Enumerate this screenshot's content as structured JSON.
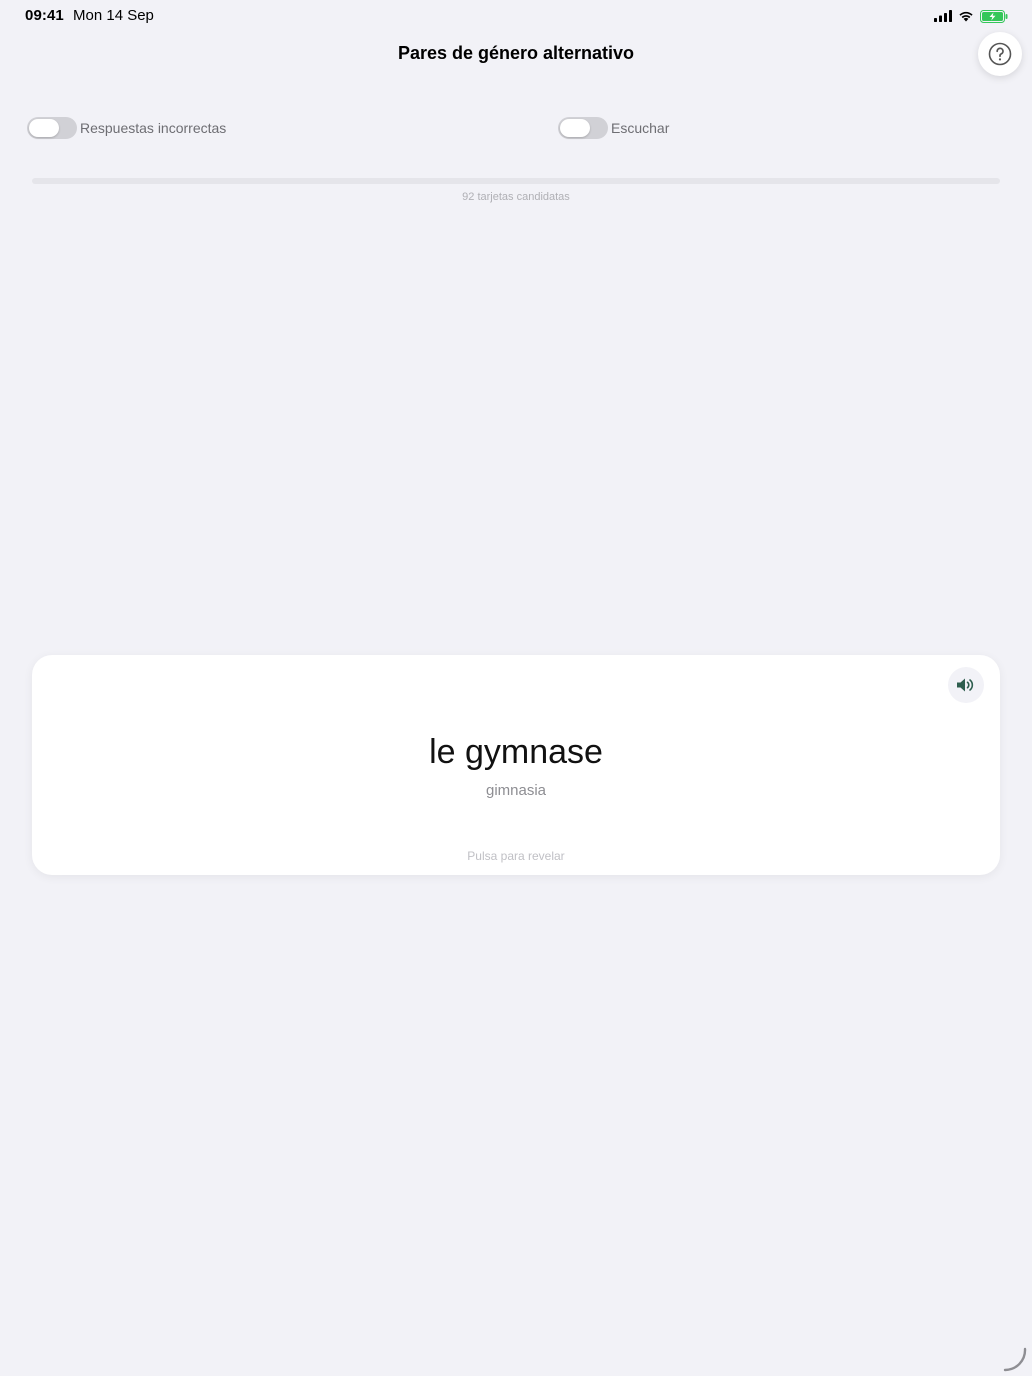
{
  "status_bar": {
    "time": "09:41",
    "date": "Mon 14 Sep",
    "icons": [
      "signal-icon",
      "wifi-icon",
      "battery-charging-icon"
    ],
    "battery_color": "#34c759"
  },
  "header": {
    "title": "Pares de género alternativo",
    "help_icon": "question-circle-icon"
  },
  "toggles": [
    {
      "label": "Respuestas incorrectas",
      "on": false
    },
    {
      "label": "Escuchar",
      "on": false
    }
  ],
  "progress": {
    "fraction": 0,
    "caption": "92 tarjetas candidatas"
  },
  "card": {
    "word": "le gymnase",
    "translation": "gimnasia",
    "hint": "Pulsa para revelar",
    "speaker_icon": "speaker-icon",
    "accent_color": "#2e5e4e"
  }
}
